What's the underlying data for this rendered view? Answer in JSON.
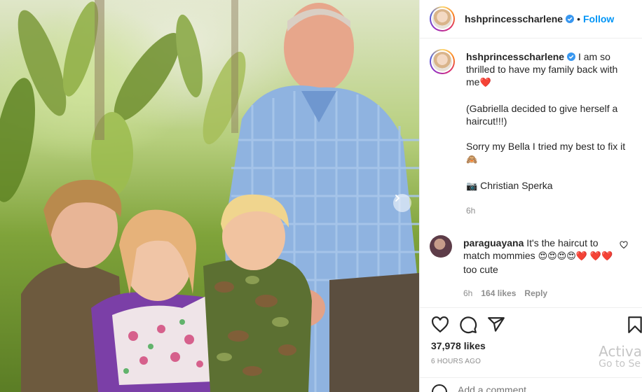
{
  "post": {
    "username": "hshprincesscharlene",
    "follow_label": "Follow",
    "caption_lines": [
      "I am so thrilled to have my family back with me",
      "(Gabriella decided to give herself a haircut!!!)",
      "Sorry my Bella I tried my best to fix it",
      "Christian Sperka"
    ],
    "caption_emoji": [
      "❤️",
      "🙈",
      "📷"
    ],
    "caption_age": "6h",
    "likes": "37,978 likes",
    "time_ago": "6 HOURS AGO",
    "add_comment_placeholder": "Add a comment..."
  },
  "comment": {
    "username": "paraguayana",
    "text": "It's the haircut to match mommies",
    "emoji_row": "😍😍😍😍❤️",
    "emoji_row2": "❤️❤️",
    "suffix": "too cute",
    "age": "6h",
    "likes": "164 likes",
    "reply": "Reply"
  },
  "watermark": {
    "line1": "Activa",
    "line2": "Go to Se"
  },
  "colors": {
    "link_blue": "#0095f6",
    "verified_blue": "#3897f0",
    "meta_grey": "#8e8e8e",
    "heart_red": "#ed4956"
  },
  "icons": [
    "verified-badge-icon",
    "heart-icon",
    "comment-icon",
    "share-icon",
    "bookmark-icon",
    "emoji-icon",
    "chevron-right-icon"
  ]
}
